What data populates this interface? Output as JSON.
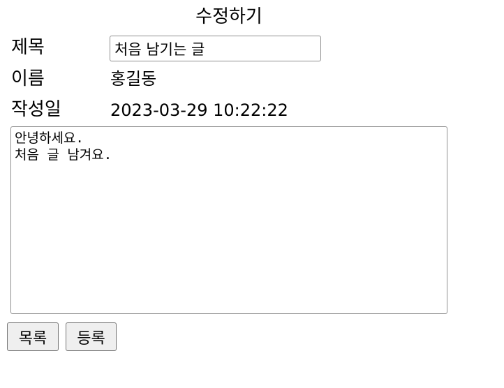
{
  "page": {
    "title": "수정하기"
  },
  "form": {
    "title_label": "제목",
    "title_value": "처음 남기는 글",
    "name_label": "이름",
    "name_value": "홍길동",
    "date_label": "작성일",
    "date_value": "2023-03-29 10:22:22",
    "content_value": "안녕하세요.\n처음 글 남겨요."
  },
  "buttons": {
    "list_label": "목록",
    "register_label": "등록"
  },
  "colors": {
    "input_border": "#8f8f8f",
    "button_background": "#efefef",
    "button_border": "#767676"
  }
}
